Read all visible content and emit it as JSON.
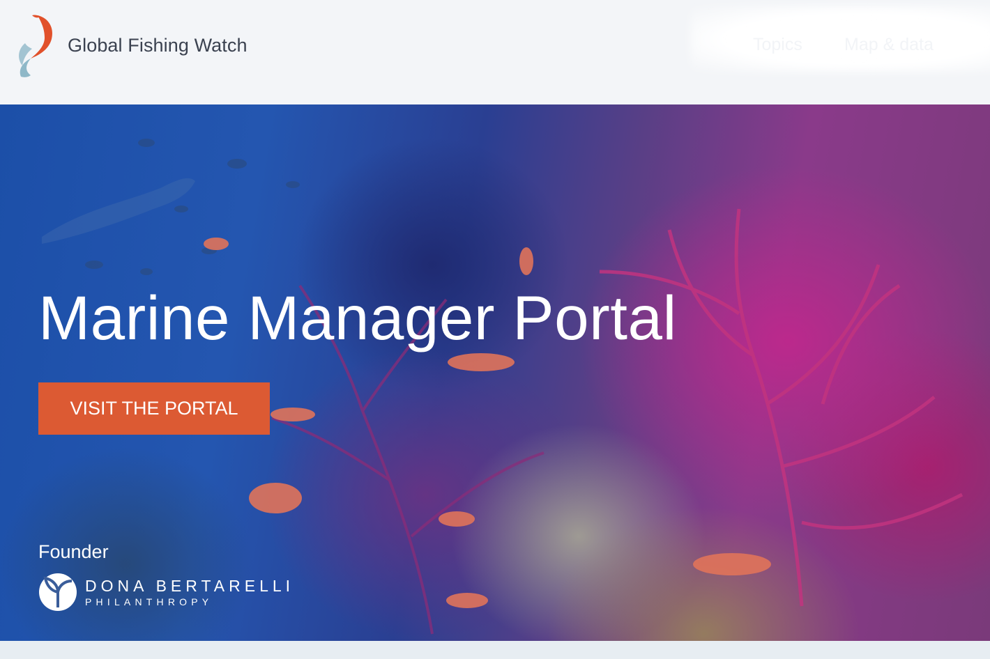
{
  "header": {
    "brand": "Global Fishing Watch",
    "logo_icon": "koi-fish-icon",
    "nav": [
      {
        "label": "Topics"
      },
      {
        "label": "Map & data"
      }
    ]
  },
  "hero": {
    "title": "Marine Manager Portal",
    "cta_label": "VISIT THE PORTAL",
    "founder_label": "Founder",
    "partner": {
      "name": "DONA BERTARELLI",
      "subtitle": "PHILANTHROPY"
    }
  },
  "colors": {
    "accent": "#dc5a33",
    "header_bg": "#f3f5f8",
    "brand_text": "#3b4250",
    "logo_orange": "#e1512b",
    "logo_blue": "#8fb8c8"
  }
}
